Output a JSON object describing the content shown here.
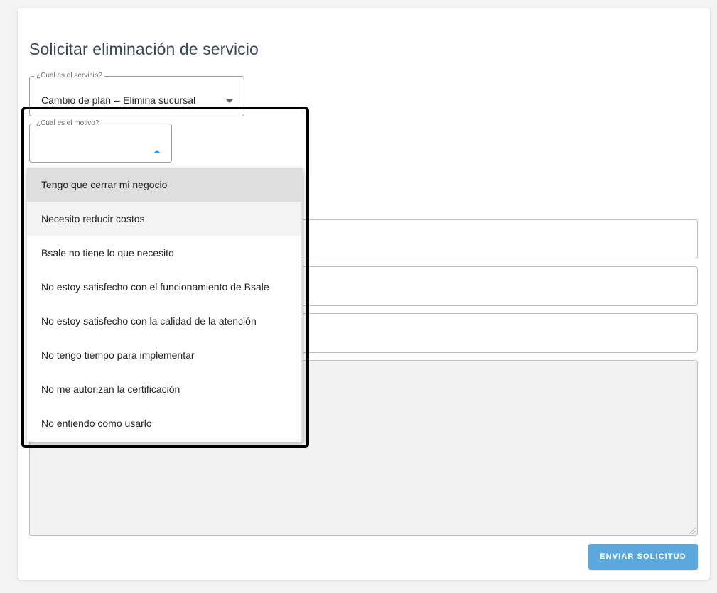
{
  "form": {
    "title": "Solicitar eliminación de servicio",
    "service_label": "¿Cual es el servicio?",
    "service_value": "Cambio de plan -- Elimina sucursal",
    "motive_label": "¿Cual es el motivo?",
    "submit_label": "ENVIAR SOLICITUD"
  },
  "dropdown": {
    "options": [
      "Tengo que cerrar mi negocio",
      "Necesito reducir costos",
      "Bsale no tiene lo que necesito",
      "No estoy satisfecho con el funcionamiento de Bsale",
      "No estoy satisfecho con la calidad de la atención",
      "No tengo tiempo para implementar",
      "No me autorizan la certificación",
      "No entiendo como usarlo"
    ]
  },
  "colors": {
    "accent": "#2196f3",
    "button": "#5ca7dc",
    "title_text": "#3c4656"
  },
  "icons": {
    "service_dropdown": "caret-down-icon",
    "motive_dropdown": "caret-up-icon"
  }
}
